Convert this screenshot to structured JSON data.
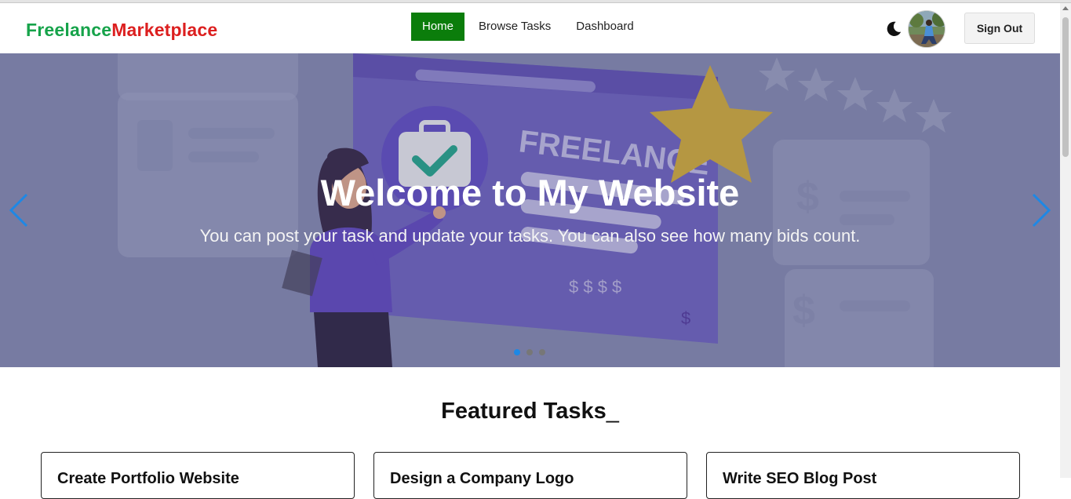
{
  "brand": {
    "part1": "Freelance",
    "part2": "Marketplace"
  },
  "nav": {
    "items": [
      {
        "label": "Home"
      },
      {
        "label": "Browse Tasks"
      },
      {
        "label": "Dashboard"
      }
    ]
  },
  "header": {
    "theme_icon": "moon-icon",
    "signout_label": "Sign Out"
  },
  "hero": {
    "title": "Welcome to My Website",
    "subtitle": "You can post your task and update your tasks. You can also see how many bids count.",
    "illustration_text": "FREELANCE",
    "slide_index": 0,
    "slide_count": 3
  },
  "featured": {
    "heading": "Featured Tasks",
    "cursor": "_",
    "cards": [
      {
        "title": "Create Portfolio Website"
      },
      {
        "title": "Design a Company Logo"
      },
      {
        "title": "Write SEO Blog Post"
      }
    ]
  },
  "colors": {
    "brand_green": "#16a34a",
    "brand_red": "#dc1f1f",
    "active_nav": "#0b7d0b",
    "arrow_blue": "#1e88e5"
  }
}
